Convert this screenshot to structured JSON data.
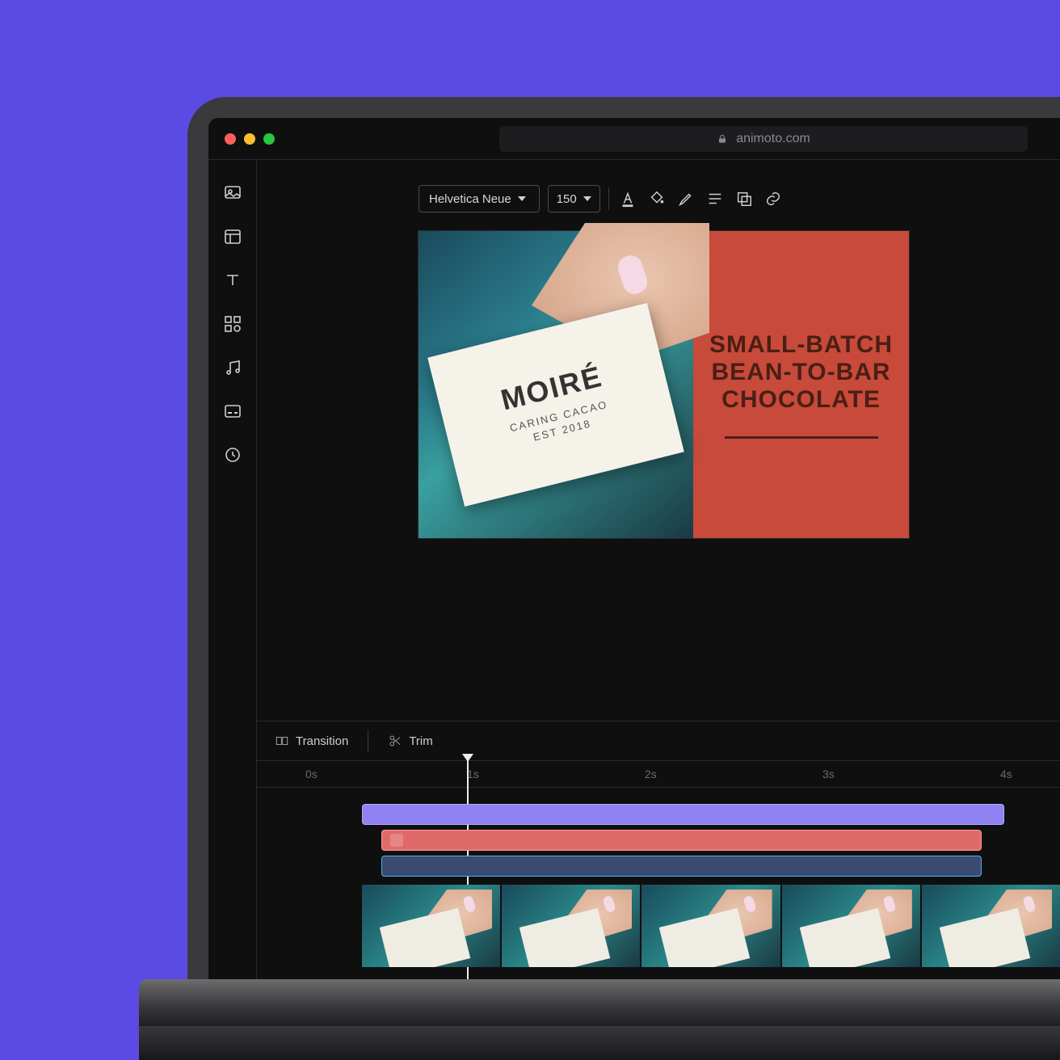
{
  "browser": {
    "address": "animoto.com"
  },
  "toolbar": {
    "font_name": "Helvetica Neue",
    "size_label": "150"
  },
  "canvas": {
    "card_brand": "MOIRÉ",
    "card_sub1": "CARING CACAO",
    "card_sub2": "EST 2018",
    "slogan_line1": "SMALL-BATCH",
    "slogan_line2": "BEAN-TO-BAR",
    "slogan_line3": "CHOCOLATE"
  },
  "timeline": {
    "tool_transition": "Transition",
    "tool_trim": "Trim",
    "marks": {
      "m0": "0s",
      "m1": "1s",
      "m2": "2s",
      "m3": "3s",
      "m4": "4s"
    }
  },
  "colors": {
    "bg": "#5b4ae4"
  }
}
